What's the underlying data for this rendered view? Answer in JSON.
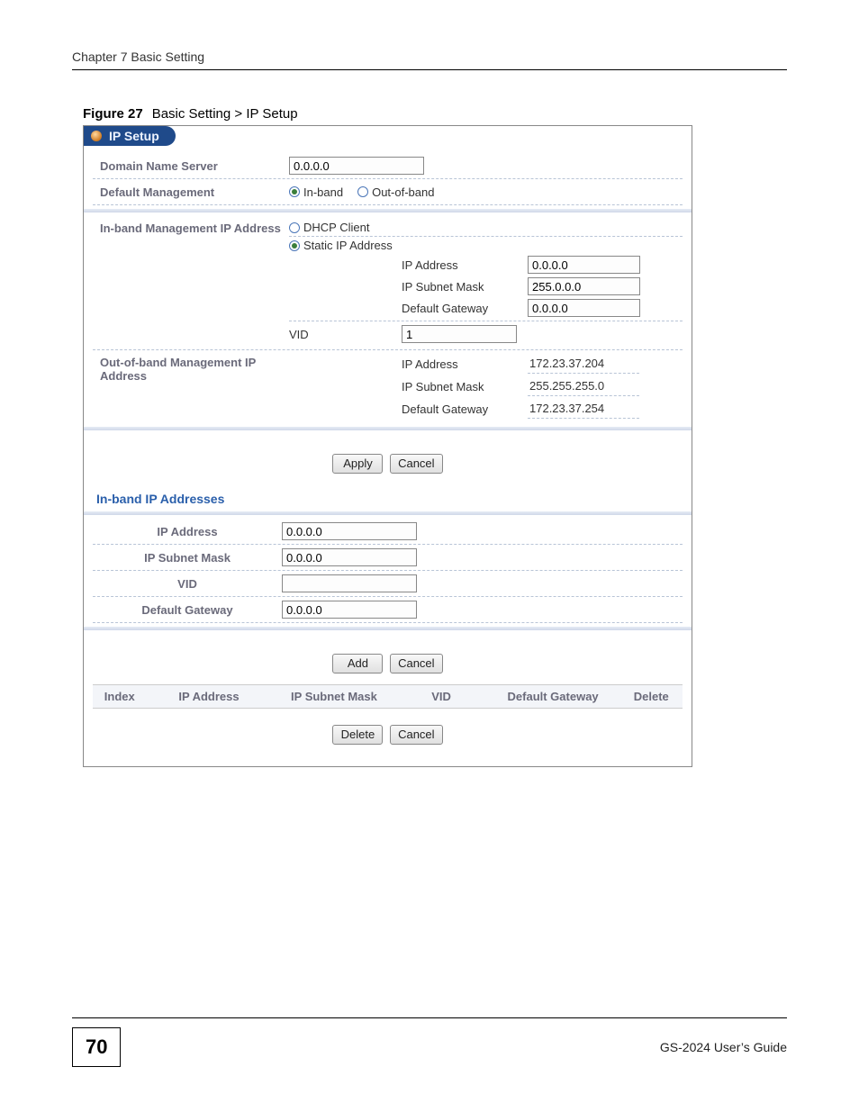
{
  "header": {
    "chapter": "Chapter 7 Basic Setting"
  },
  "figure": {
    "number": "Figure 27",
    "separator": "   ",
    "caption": "Basic Setting > IP Setup"
  },
  "panel": {
    "tab_title": "IP Setup",
    "dns": {
      "label": "Domain Name Server",
      "value": "0.0.0.0"
    },
    "default_mgmt": {
      "label": "Default Management",
      "opt_inband": "In-band",
      "opt_outofband": "Out-of-band"
    },
    "inband": {
      "label": "In-band Management IP Address",
      "opt_dhcp": "DHCP Client",
      "opt_static": "Static IP Address",
      "ip_label": "IP Address",
      "ip_value": "0.0.0.0",
      "mask_label": "IP Subnet Mask",
      "mask_value": "255.0.0.0",
      "gw_label": "Default Gateway",
      "gw_value": "0.0.0.0",
      "vid_label": "VID",
      "vid_value": "1"
    },
    "outband": {
      "label": "Out-of-band Management IP Address",
      "ip_label": "IP Address",
      "ip_value": "172.23.37.204",
      "mask_label": "IP Subnet Mask",
      "mask_value": "255.255.255.0",
      "gw_label": "Default Gateway",
      "gw_value": "172.23.37.254"
    },
    "btn_apply": "Apply",
    "btn_cancel": "Cancel",
    "addlist": {
      "title": "In-band IP Addresses",
      "ip_label": "IP Address",
      "ip_value": "0.0.0.0",
      "mask_label": "IP Subnet Mask",
      "mask_value": "0.0.0.0",
      "vid_label": "VID",
      "vid_value": "",
      "gw_label": "Default Gateway",
      "gw_value": "0.0.0.0",
      "btn_add": "Add"
    },
    "table": {
      "h_index": "Index",
      "h_ip": "IP Address",
      "h_mask": "IP Subnet Mask",
      "h_vid": "VID",
      "h_gw": "Default Gateway",
      "h_del": "Delete"
    },
    "btn_delete": "Delete"
  },
  "footer": {
    "page_number": "70",
    "guide": "GS-2024 User’s Guide"
  }
}
